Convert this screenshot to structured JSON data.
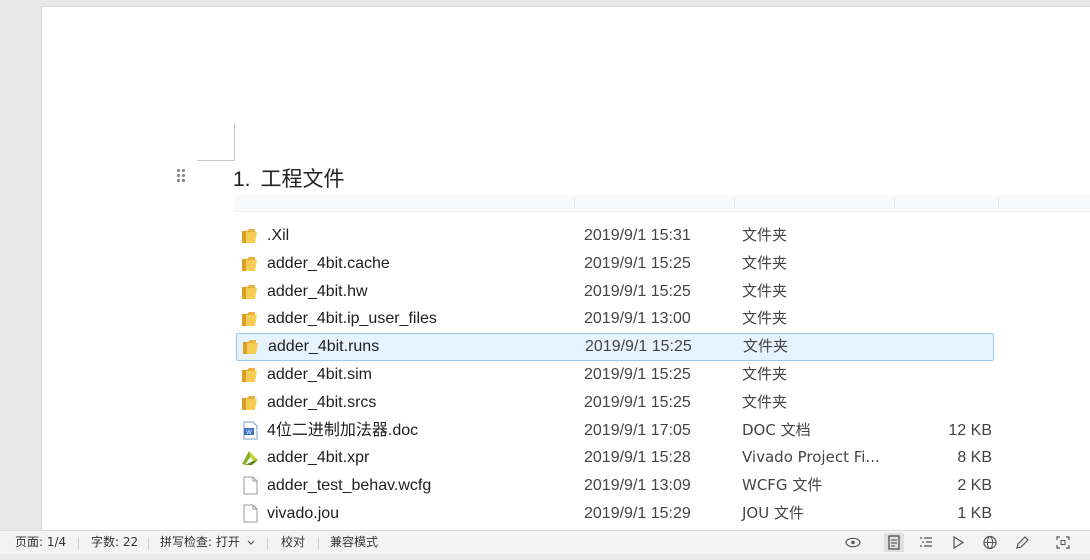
{
  "document": {
    "heading_number": "1.",
    "heading_text": "工程文件"
  },
  "explorer": {
    "files": [
      {
        "name": ".Xil",
        "date": "2019/9/1 15:31",
        "type": "文件夹",
        "size": "",
        "icon": "folder-icon"
      },
      {
        "name": "adder_4bit.cache",
        "date": "2019/9/1 15:25",
        "type": "文件夹",
        "size": "",
        "icon": "folder-icon"
      },
      {
        "name": "adder_4bit.hw",
        "date": "2019/9/1 15:25",
        "type": "文件夹",
        "size": "",
        "icon": "folder-icon"
      },
      {
        "name": "adder_4bit.ip_user_files",
        "date": "2019/9/1 13:00",
        "type": "文件夹",
        "size": "",
        "icon": "folder-icon"
      },
      {
        "name": "adder_4bit.runs",
        "date": "2019/9/1 15:25",
        "type": "文件夹",
        "size": "",
        "icon": "folder-icon",
        "selected": true
      },
      {
        "name": "adder_4bit.sim",
        "date": "2019/9/1 15:25",
        "type": "文件夹",
        "size": "",
        "icon": "folder-icon"
      },
      {
        "name": "adder_4bit.srcs",
        "date": "2019/9/1 15:25",
        "type": "文件夹",
        "size": "",
        "icon": "folder-icon"
      },
      {
        "name": "4位二进制加法器.doc",
        "date": "2019/9/1 17:05",
        "type": "DOC 文档",
        "size": "12 KB",
        "icon": "word-doc-icon"
      },
      {
        "name": "adder_4bit.xpr",
        "date": "2019/9/1 15:28",
        "type": "Vivado Project Fi...",
        "size": "8 KB",
        "icon": "vivado-project-icon"
      },
      {
        "name": "adder_test_behav.wcfg",
        "date": "2019/9/1 13:09",
        "type": "WCFG 文件",
        "size": "2 KB",
        "icon": "file-icon"
      },
      {
        "name": "vivado.jou",
        "date": "2019/9/1 15:29",
        "type": "JOU 文件",
        "size": "1 KB",
        "icon": "file-icon"
      }
    ]
  },
  "statusbar": {
    "page": "页面: 1/4",
    "word_count": "字数: 22",
    "spell_check": "拼写检查: 打开",
    "proofread": "校对",
    "compat_mode": "兼容模式",
    "icons": [
      "eye-icon",
      "page-view-icon",
      "outline-view-icon",
      "play-icon",
      "web-view-icon",
      "pen-icon",
      "focus-icon"
    ]
  }
}
